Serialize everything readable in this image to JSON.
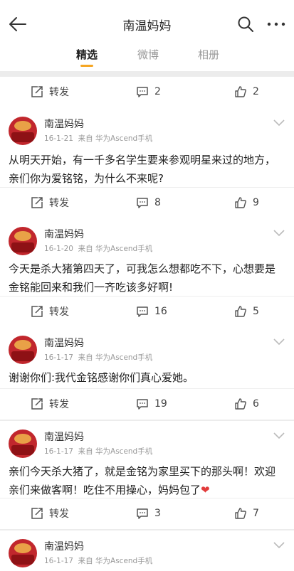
{
  "header": {
    "title": "南温妈妈"
  },
  "tabs": [
    {
      "label": "精选"
    },
    {
      "label": "微博"
    },
    {
      "label": "相册"
    }
  ],
  "top_actions": {
    "repost": "转发",
    "comments": "2",
    "likes": "2"
  },
  "posts": [
    {
      "author": "南温妈妈",
      "date": "16-1-21",
      "source_label": "来自",
      "source": "华为Ascend手机",
      "text": "从明天开始，有一千多名学生要来参观明星来过的地方，亲们你为爱铭铭，为什么不来呢?",
      "repost": "转发",
      "comments": "8",
      "likes": "9"
    },
    {
      "author": "南温妈妈",
      "date": "16-1-20",
      "source_label": "来自",
      "source": "华为Ascend手机",
      "text": "今天是杀大猪第四天了，可我怎么想都吃不下，心想要是金铭能回来和我们一齐吃该多好啊!",
      "repost": "转发",
      "comments": "16",
      "likes": "5"
    },
    {
      "author": "南温妈妈",
      "date": "16-1-17",
      "source_label": "来自",
      "source": "华为Ascend手机",
      "text": "谢谢你们:我代金铭感谢你们真心爱她。",
      "repost": "转发",
      "comments": "19",
      "likes": "6"
    },
    {
      "author": "南温妈妈",
      "date": "16-1-17",
      "source_label": "来自",
      "source": "华为Ascend手机",
      "text": "亲们今天杀大猪了，就是金铭为家里买下的那头啊！欢迎亲们来做客啊！吃住不用操心，妈妈包了",
      "emoji": "❤",
      "repost": "转发",
      "comments": "3",
      "likes": "7"
    },
    {
      "author": "南温妈妈",
      "date": "16-1-17",
      "source_label": "来自",
      "source": "华为Ascend手机"
    }
  ],
  "colors": {
    "accent": "#f6a623",
    "heart": "#e23b3b",
    "avatar": "#c1272d"
  },
  "icons": {
    "back": "arrow-left-icon",
    "search": "search-icon",
    "more": "more-dots-icon",
    "repost": "repost-icon",
    "comment": "comment-icon",
    "like": "thumbs-up-icon",
    "expand": "chevron-down-icon"
  }
}
